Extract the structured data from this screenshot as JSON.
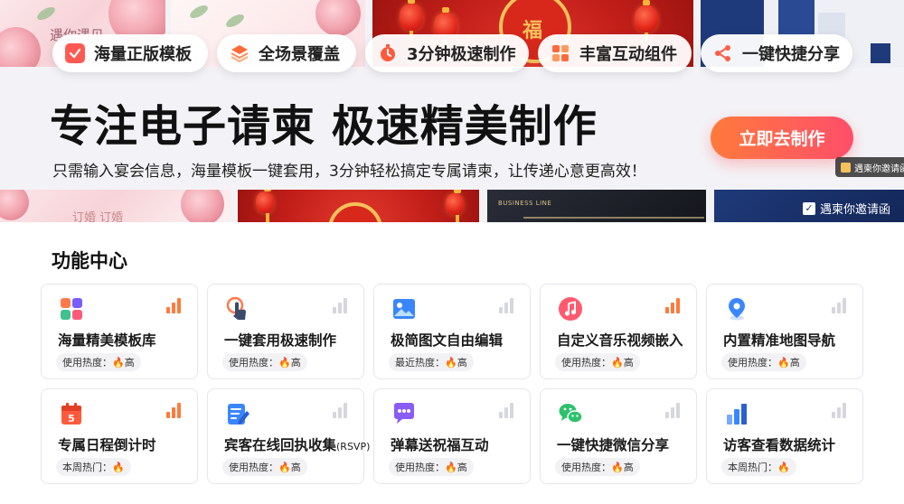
{
  "hero": {
    "chips": [
      {
        "label": "海量正版模板",
        "icon": "check-square-icon",
        "color": "#ff5a52"
      },
      {
        "label": "全场景覆盖",
        "icon": "layers-icon",
        "color": "#ff6b35"
      },
      {
        "label": "3分钟极速制作",
        "icon": "stopwatch-icon",
        "color": "#ff5a3c"
      },
      {
        "label": "丰富互动组件",
        "icon": "grid-icon",
        "color": "#ff6a3d"
      },
      {
        "label": "一键快捷分享",
        "icon": "share-icon",
        "color": "#ff5c47"
      }
    ],
    "headline": "专注电子请柬 极速精美制作",
    "subline": "只需输入宴会信息，海量模板一键套用，3分钟轻松搞定专属请柬，让传递心意更高效！",
    "cta": "立即去制作",
    "tag_small": "遇柬你邀请函",
    "tag_strip": "遇柬你邀请函",
    "template_texts": {
      "floral_top": "遇你遇见",
      "floral_bottom": "订婚  订婚",
      "red_fu": "福",
      "business": "BUSINESS LINE"
    }
  },
  "features": {
    "title": "功能中心",
    "cards": [
      {
        "title": "海量精美模板库",
        "badge": "使用热度：🔥高",
        "icon": "apps-icon",
        "hot": true
      },
      {
        "title": "一键套用极速制作",
        "badge": "使用热度：🔥高",
        "icon": "tap-icon",
        "hot": false
      },
      {
        "title": "极简图文自由编辑",
        "badge": "最近热度：🔥高",
        "icon": "image-icon",
        "hot": false
      },
      {
        "title": "自定义音乐视频嵌入",
        "badge": "使用热度：🔥高",
        "icon": "music-icon",
        "hot": true
      },
      {
        "title": "内置精准地图导航",
        "badge": "使用热度：🔥高",
        "icon": "map-pin-icon",
        "hot": false
      },
      {
        "title": "专属日程倒计时",
        "badge": "本周热门：🔥",
        "icon": "calendar-icon",
        "hot": true
      },
      {
        "title": "宾客在线回执收集",
        "title_suffix": "(RSVP)",
        "badge": "使用热度：🔥高",
        "icon": "edit-form-icon",
        "hot": false
      },
      {
        "title": "弹幕送祝福互动",
        "badge": "使用热度：🔥高",
        "icon": "chat-bubble-icon",
        "hot": false
      },
      {
        "title": "一键快捷微信分享",
        "badge": "使用热度：🔥高",
        "icon": "wechat-icon",
        "hot": false
      },
      {
        "title": "访客查看数据统计",
        "badge": "本周热门：🔥",
        "icon": "bar-chart-icon",
        "hot": false
      }
    ]
  },
  "colors": {
    "accent_orange": "#ff7a3c",
    "accent_pink": "#ff4e6a",
    "hot_bars": "#ff7a3c"
  }
}
